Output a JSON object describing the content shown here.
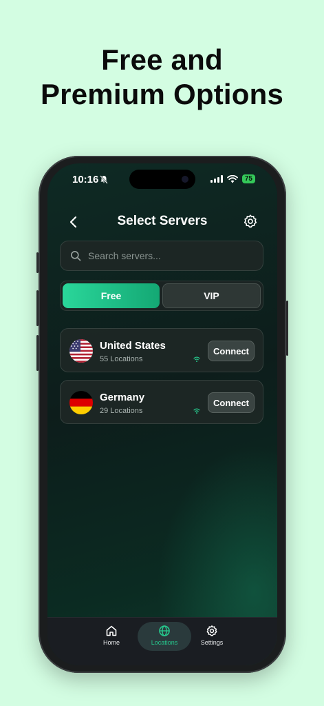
{
  "headline": {
    "line1": "Free and",
    "line2": "Premium Options"
  },
  "status_bar": {
    "time": "10:16",
    "battery": "75"
  },
  "nav": {
    "title": "Select Servers"
  },
  "search": {
    "placeholder": "Search servers..."
  },
  "tabs": [
    {
      "label": "Free",
      "active": true
    },
    {
      "label": "VIP",
      "active": false
    }
  ],
  "servers": [
    {
      "country": "United States",
      "locations": "55 Locations",
      "connect_label": "Connect",
      "flag": "us-flag-icon"
    },
    {
      "country": "Germany",
      "locations": "29 Locations",
      "connect_label": "Connect",
      "flag": "germany-flag-icon"
    }
  ],
  "tabbar": {
    "items": [
      {
        "label": "Home",
        "icon": "home-icon"
      },
      {
        "label": "Locations",
        "icon": "globe-icon",
        "active": true
      },
      {
        "label": "Settings",
        "icon": "gear-icon"
      }
    ]
  },
  "colors": {
    "background": "#d3fde2",
    "accent": "#26c98d",
    "battery": "#34c759"
  }
}
